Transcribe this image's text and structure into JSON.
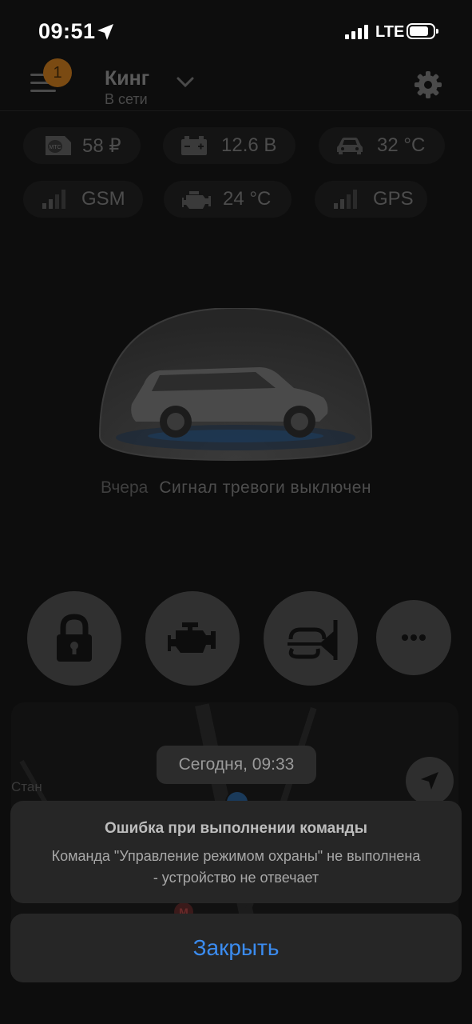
{
  "status_bar": {
    "time": "09:51",
    "network": "LTE"
  },
  "header": {
    "notifications_count": "1",
    "car_name": "Кинг",
    "car_status": "В сети"
  },
  "chips": {
    "balance": "58 ₽",
    "voltage": "12.6 В",
    "cabin_temp": "32 °C",
    "gsm": "GSM",
    "engine_temp": "24 °C",
    "gps": "GPS",
    "operator_logo": "МТС"
  },
  "event": {
    "when": "Вчера",
    "message": "Сигнал тревоги выключен"
  },
  "actions": {
    "lock": "lock-icon",
    "engine": "engine-icon",
    "horn": "horn-icon",
    "more": "more-icon"
  },
  "map": {
    "timestamp": "Сегодня, 09:33",
    "street_fragment": "Стан",
    "metro_icon": "М"
  },
  "alert": {
    "title": "Ошибка при выполнении команды",
    "body": "Команда \"Управление режимом охраны\" не выполнена - устройство не отвечает",
    "close_label": "Закрыть"
  },
  "colors": {
    "background": "#0d0d0d",
    "accent": "#3b8cf0",
    "badge": "#7a4a12",
    "sheet": "#262626"
  }
}
